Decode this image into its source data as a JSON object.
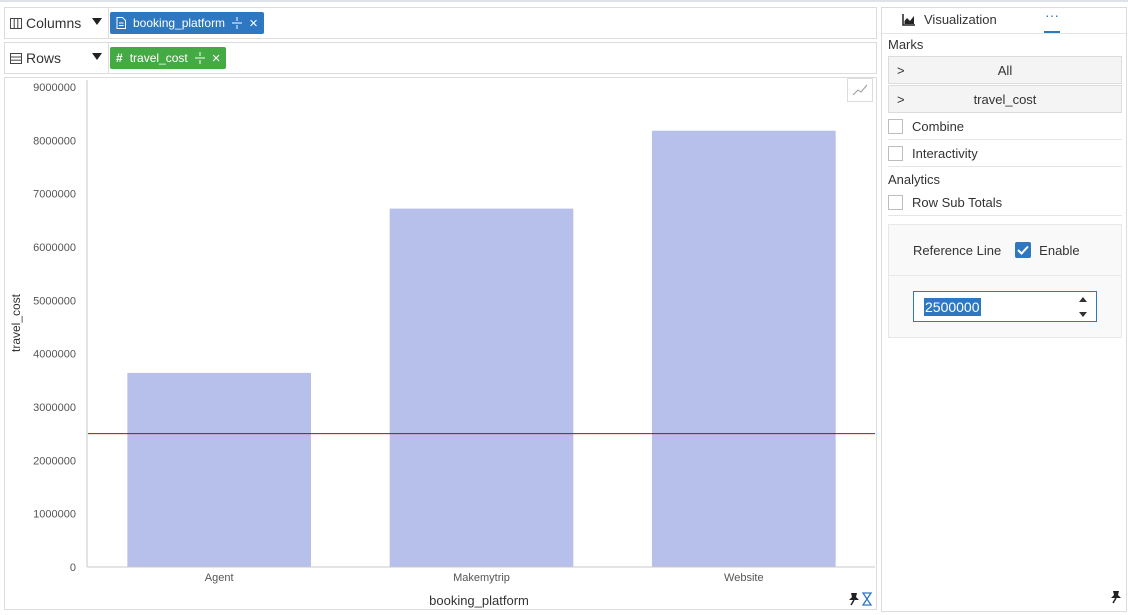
{
  "shelves": {
    "columns": {
      "label": "Columns",
      "pill": "booking_platform"
    },
    "rows": {
      "label": "Rows",
      "pill": "travel_cost"
    }
  },
  "colors": {
    "accent": "#2e77c1",
    "dimension_pill": "#2e77c1",
    "measure_pill": "#44aa44",
    "bar": "#b6c0ea",
    "reference_line": "#cc0000"
  },
  "icons": {
    "columns": "columns-grid-icon",
    "rows": "rows-list-icon",
    "dimension": "document-icon",
    "measure": "hash-icon",
    "trend": "trend-line-icon",
    "pin": "pin-icon",
    "hourglass": "hourglass-icon",
    "visualization": "area-chart-icon"
  },
  "chart_data": {
    "type": "bar",
    "categories": [
      "Agent",
      "Makemytrip",
      "Website"
    ],
    "series": [
      {
        "values": [
          3640000,
          6720000,
          8180000
        ]
      }
    ],
    "xlabel": "booking_platform",
    "ylabel": "travel_cost",
    "ylim": [
      0,
      9000000
    ],
    "yticks": [
      "0",
      "1000000",
      "2000000",
      "3000000",
      "4000000",
      "5000000",
      "6000000",
      "7000000",
      "8000000",
      "9000000"
    ],
    "reference_line": 2500000,
    "grid": false
  },
  "panel": {
    "tab_visualization": "Visualization",
    "tab_more": "···",
    "marks_title": "Marks",
    "marks_items": [
      "All",
      "travel_cost"
    ],
    "combine": "Combine",
    "interactivity": "Interactivity",
    "analytics_title": "Analytics",
    "row_sub_totals": "Row Sub Totals",
    "reference_line_label": "Reference Line",
    "enable_label": "Enable",
    "reference_value": "2500000"
  }
}
